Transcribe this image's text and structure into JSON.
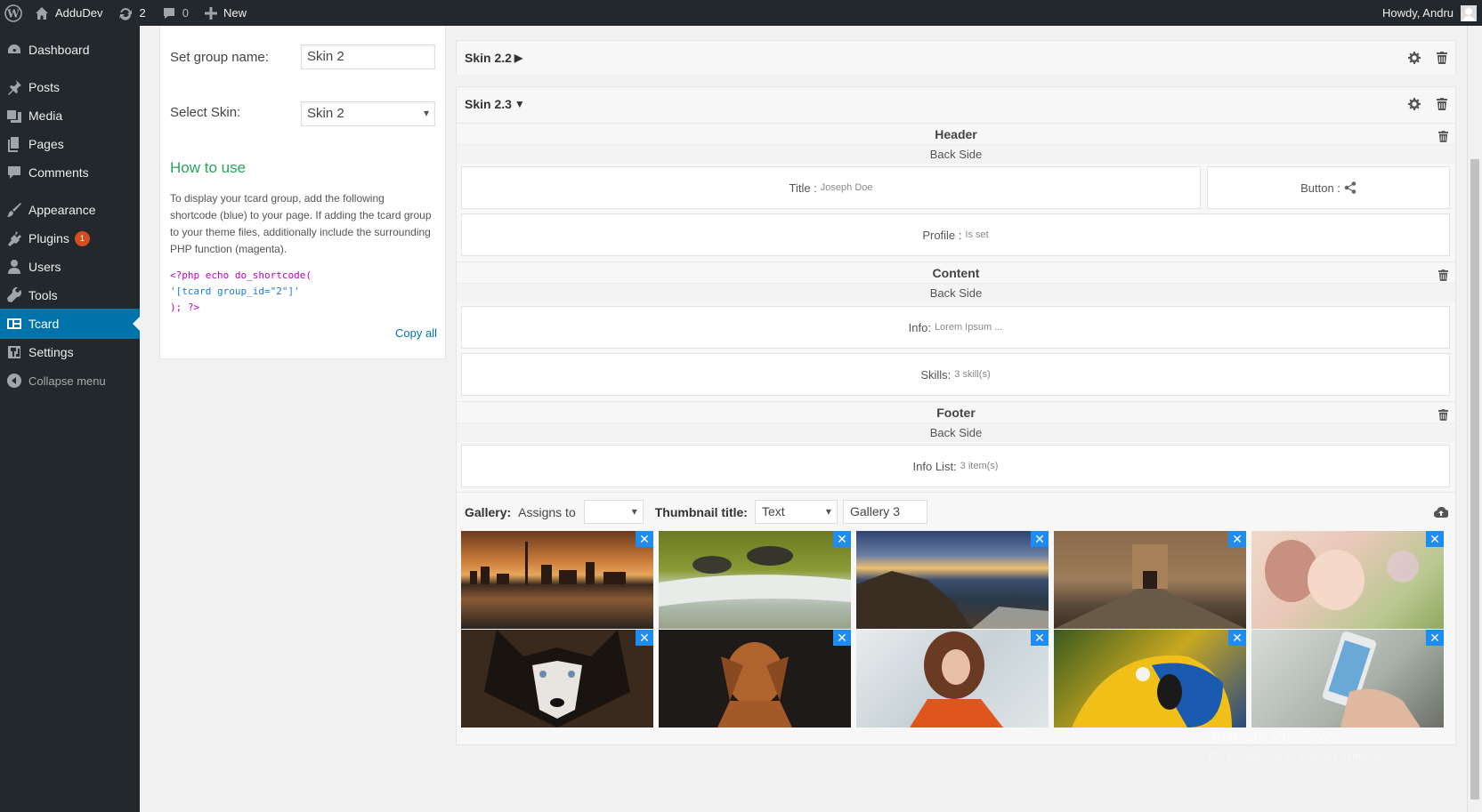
{
  "adminbar": {
    "site_name": "AdduDev",
    "updates_count": "2",
    "comments_count": "0",
    "new_label": "New",
    "howdy": "Howdy, Andru"
  },
  "sidebar": {
    "items": [
      {
        "label": "Dashboard",
        "icon": "dashboard-icon"
      },
      {
        "label": "Posts",
        "icon": "pin-icon"
      },
      {
        "label": "Media",
        "icon": "media-icon"
      },
      {
        "label": "Pages",
        "icon": "pages-icon"
      },
      {
        "label": "Comments",
        "icon": "comment-icon"
      },
      {
        "label": "Appearance",
        "icon": "brush-icon"
      },
      {
        "label": "Plugins",
        "icon": "plugin-icon",
        "badge": "1"
      },
      {
        "label": "Users",
        "icon": "user-icon"
      },
      {
        "label": "Tools",
        "icon": "wrench-icon"
      },
      {
        "label": "Tcard",
        "icon": "tcard-icon",
        "current": true
      },
      {
        "label": "Settings",
        "icon": "settings-icon"
      },
      {
        "label": "Collapse menu",
        "icon": "collapse-icon"
      }
    ]
  },
  "left_panel": {
    "group_name_label": "Set group name:",
    "group_name_value": "Skin 2",
    "select_skin_label": "Select Skin:",
    "select_skin_value": "Skin 2",
    "howto_title": "How to use",
    "howto_text": "To display your tcard group, add the following shortcode (blue) to your page. If adding the tcard group to your theme files, additionally include the surrounding PHP function (magenta).",
    "code_line1": "<?php echo do_shortcode(",
    "code_line2": "'[tcard group_id=\"2\"]'",
    "code_line3": "); ?>",
    "copy_all": "Copy all"
  },
  "skin22": {
    "title": "Skin 2.2"
  },
  "skin23": {
    "title": "Skin 2.3",
    "header": {
      "title": "Header",
      "sub": "Back Side",
      "title_label": "Title :",
      "title_value": "Joseph Doe",
      "button_label": "Button :",
      "profile_label": "Profile :",
      "profile_value": "Is set"
    },
    "content": {
      "title": "Content",
      "sub": "Back Side",
      "info_label": "Info:",
      "info_value": "Lorem Ipsum ...",
      "skills_label": "Skills:",
      "skills_value": "3 skill(s)"
    },
    "footer": {
      "title": "Footer",
      "sub": "Back Side",
      "infolist_label": "Info List:",
      "infolist_value": "3 item(s)"
    },
    "gallery": {
      "label": "Gallery:",
      "assigns_label": "Assigns to",
      "assigns_value": "",
      "thumb_title_label": "Thumbnail title:",
      "thumb_title_value": "Text",
      "gallery_name": "Gallery 3",
      "images": [
        "city-skyline",
        "turtles",
        "sea-sunset",
        "courtyard",
        "mother-baby",
        "husky-dog",
        "vizsla-dog",
        "curly-woman",
        "macaw-parrot",
        "phone-hand"
      ]
    }
  },
  "watermark": {
    "line1": "Activate Windows",
    "line2": "Go to Settings to activate Windows."
  },
  "colors": {
    "sidebar_bg": "#23282d",
    "current_bg": "#0073aa",
    "howto_green": "#27a55a",
    "close_blue": "#1e8cf0",
    "badge_orange": "#d54e21"
  }
}
